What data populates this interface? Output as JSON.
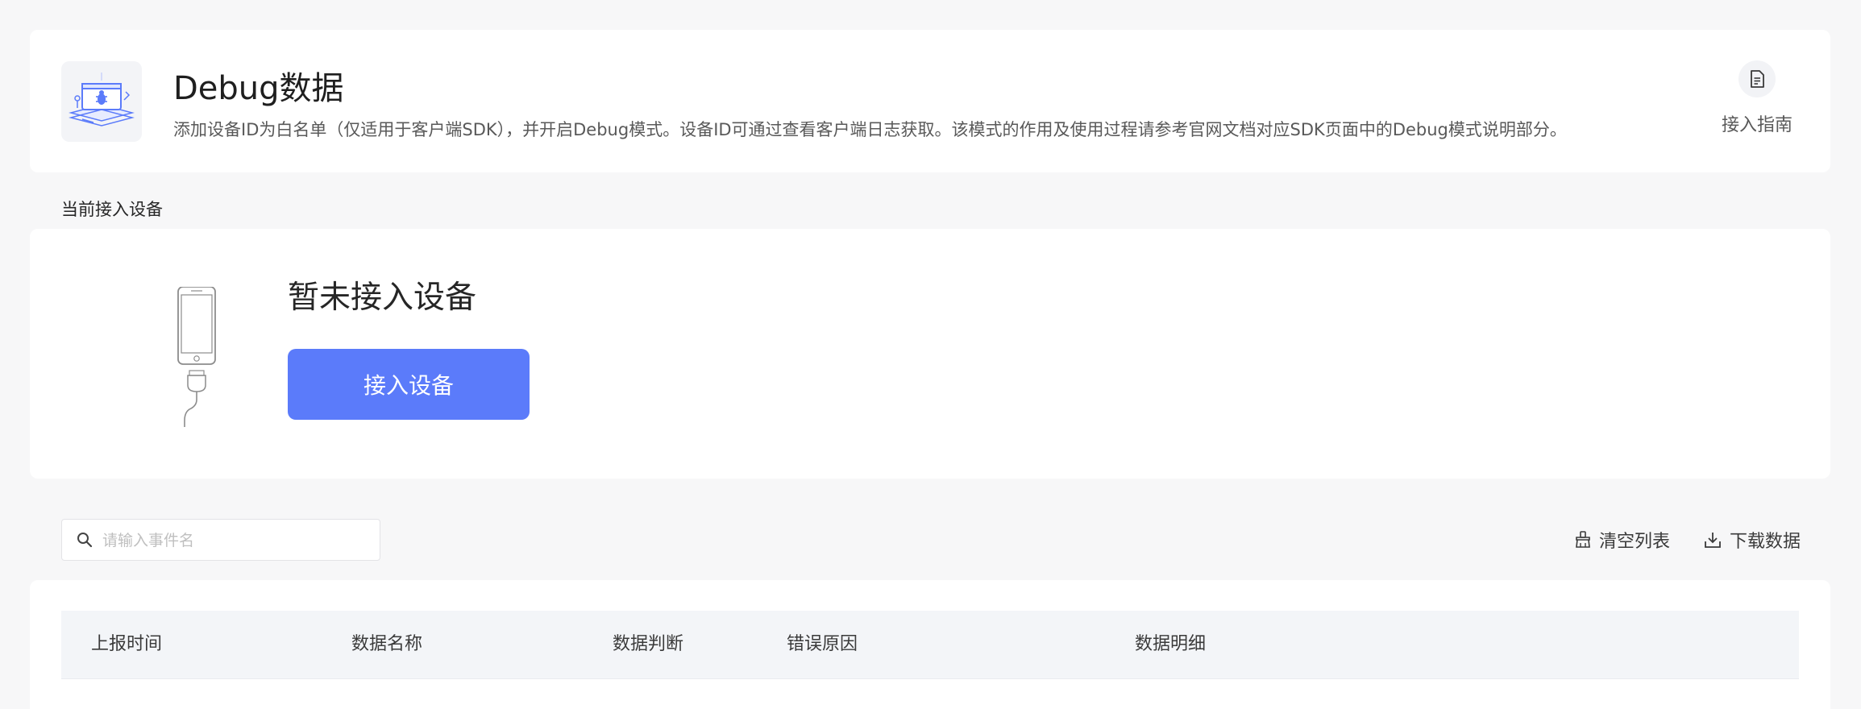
{
  "header": {
    "title": "Debug数据",
    "description": "添加设备ID为白名单（仅适用于客户端SDK），并开启Debug模式。设备ID可通过查看客户端日志获取。该模式的作用及使用过程请参考官网文档对应SDK页面中的Debug模式说明部分。",
    "icon": "debug-bug-icon",
    "guide_label": "接入指南",
    "guide_icon": "document-icon"
  },
  "device_section": {
    "title": "当前接入设备",
    "status": "暂未接入设备",
    "connect_button_label": "接入设备",
    "illustration_icon": "phone-cable-icon"
  },
  "toolbar": {
    "search_placeholder": "请输入事件名",
    "search_value": "",
    "clear_label": "清空列表",
    "clear_icon": "broom-icon",
    "download_label": "下载数据",
    "download_icon": "download-icon"
  },
  "table": {
    "columns": [
      "上报时间",
      "数据名称",
      "数据判断",
      "错误原因",
      "数据明细"
    ],
    "rows": []
  },
  "colors": {
    "primary": "#5b7bfa",
    "background": "#f7f7f8",
    "card": "#ffffff",
    "table_header": "#f3f5f8"
  }
}
